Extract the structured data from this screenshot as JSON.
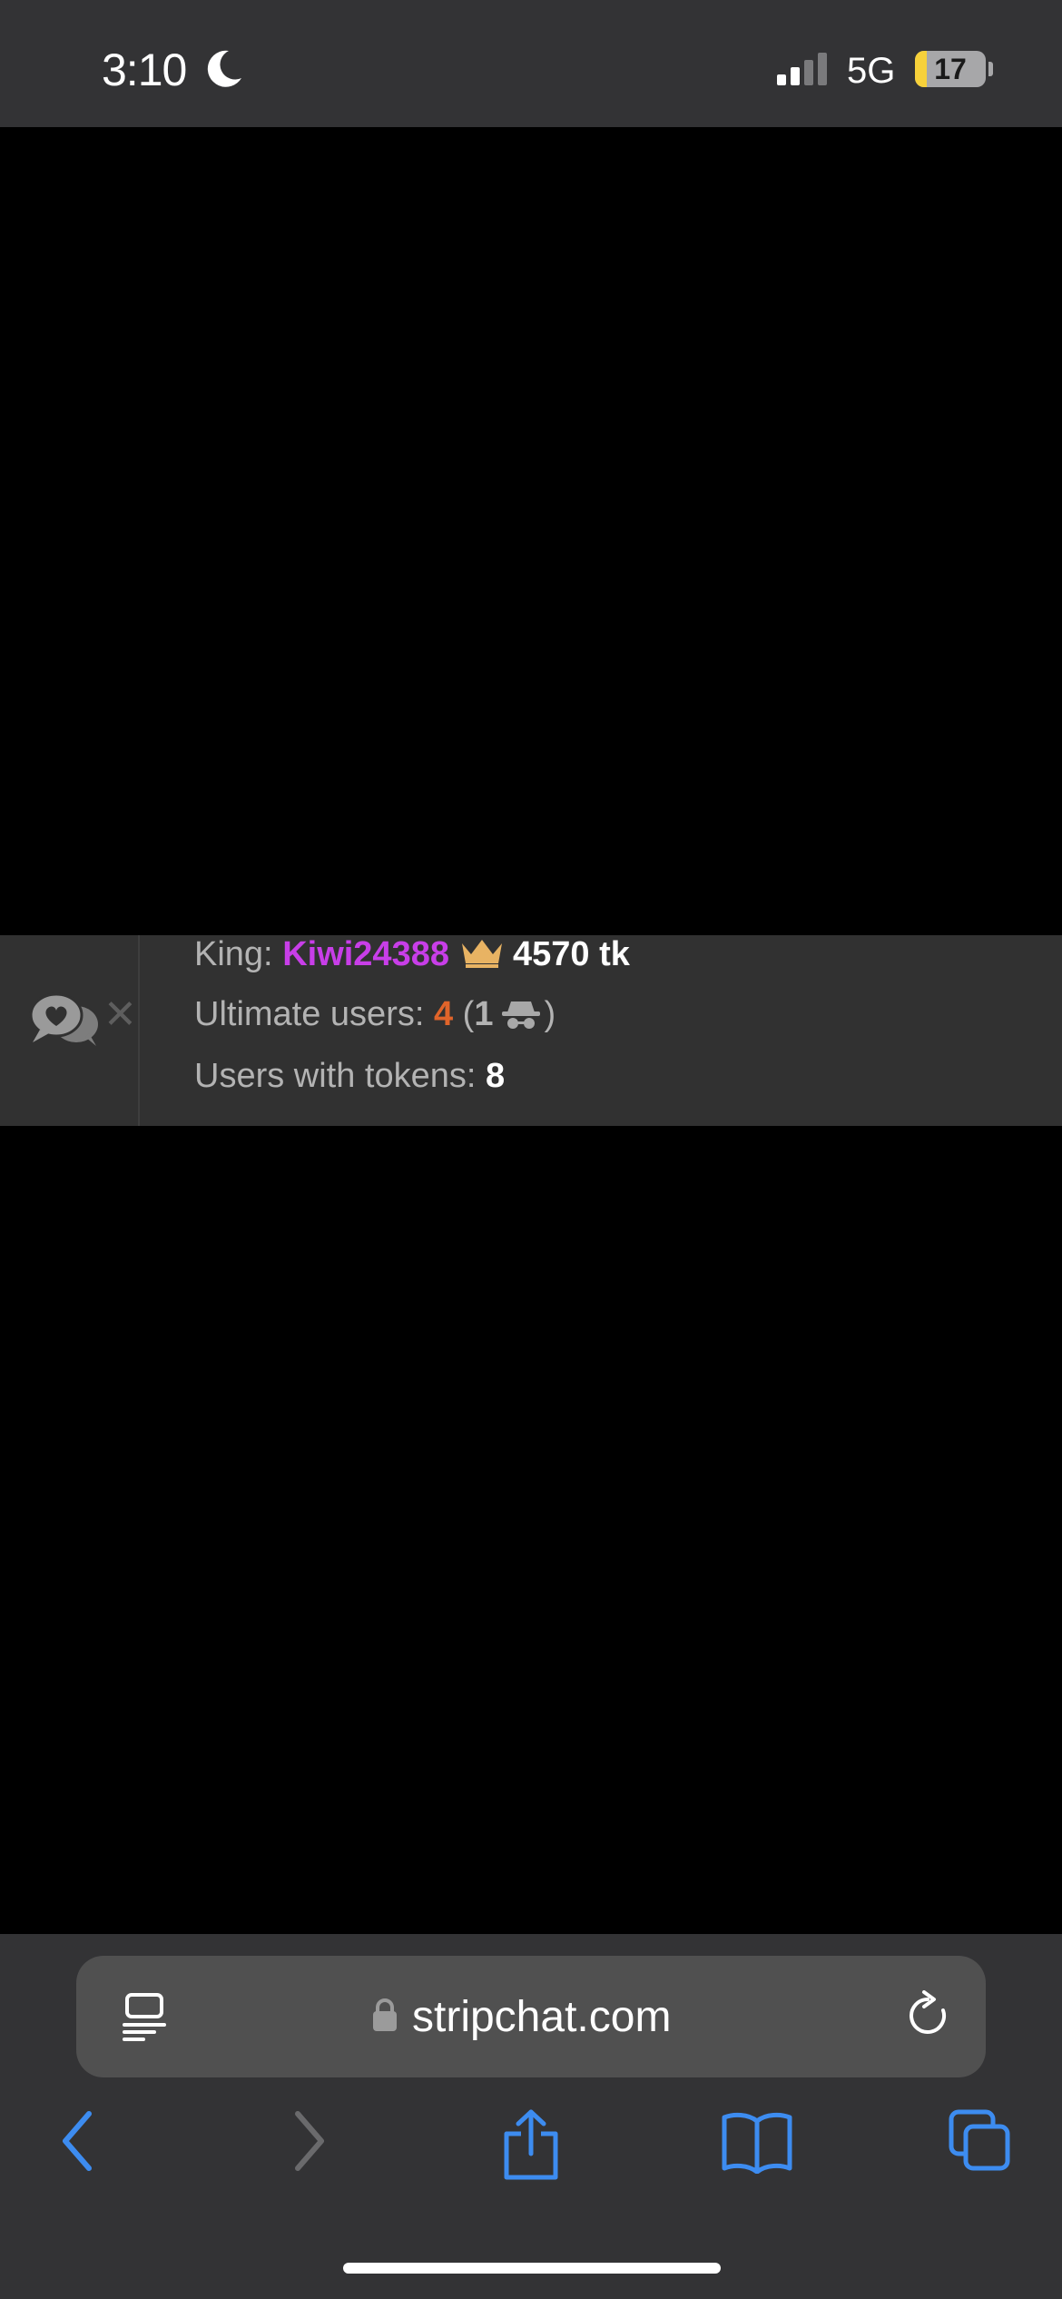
{
  "status_bar": {
    "time": "3:10",
    "network": "5G",
    "battery": "17",
    "battery_level": 0.17
  },
  "info_panel": {
    "king_label": "King:",
    "king_name": "Kiwi24388",
    "king_tokens": "4570 tk",
    "ultimate_label": "Ultimate users:",
    "ultimate_count": "4",
    "anon_open": "(",
    "anon_count": "1",
    "anon_close": ")",
    "tokens_label": "Users with tokens:",
    "tokens_count": "8",
    "close_symbol": "✕"
  },
  "browser": {
    "url": "stripchat.com"
  },
  "colors": {
    "king_name": "#c83ee8",
    "ultimate_count": "#e0642a",
    "crown": "#e8b363",
    "accent": "#3d8cf0"
  }
}
